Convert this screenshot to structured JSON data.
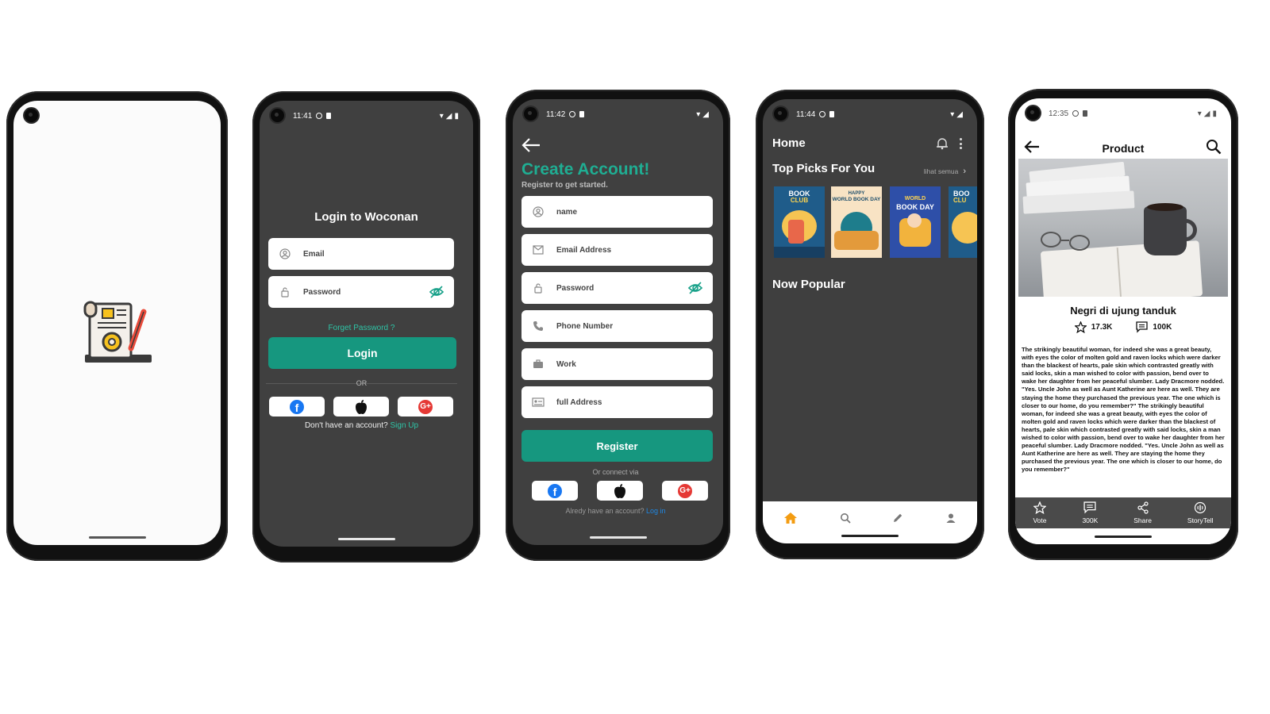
{
  "login": {
    "time": "11:41",
    "title": "Login to Woconan",
    "email_placeholder": "Email",
    "password_placeholder": "Password",
    "forgot": "Forget Password ?",
    "login_button": "Login",
    "or": "OR",
    "no_account": "Don't have an account?",
    "signup": "Sign Up"
  },
  "register": {
    "time": "11:42",
    "title": "Create Account!",
    "subtitle": "Register to get started.",
    "fields": [
      "name",
      "Email Address",
      "Password",
      "Phone Number",
      "Work",
      "full Address"
    ],
    "register_button": "Register",
    "connect_via": "Or connect via",
    "have_account": "Alredy have an account?",
    "login_link": "Log in"
  },
  "home": {
    "time": "11:44",
    "title": "Home",
    "top_picks": "Top Picks For You",
    "see_all": "lihat semua",
    "now_popular": "Now Popular",
    "covers": [
      {
        "line1": "BOOK",
        "line2": "CLUB"
      },
      {
        "line1": "HAPPY",
        "line2": "WORLD BOOK DAY"
      },
      {
        "line1": "WORLD",
        "line2": "BOOK DAY"
      },
      {
        "line1": "BOO",
        "line2": "CLU"
      }
    ]
  },
  "product": {
    "time": "12:35",
    "title": "Product",
    "book_title": "Negri di ujung tanduk",
    "votes": "17.3K",
    "comments": "100K",
    "description": "The strikingly beautiful woman, for indeed she was a great beauty, with eyes the color of molten gold and raven locks which were darker than the blackest of hearts, pale skin which contrasted greatly with said locks, skin a man wished to color with passion, bend over to wake her daughter from her peaceful slumber. Lady Dracmore nodded. \"Yes. Uncle John as well as Aunt Katherine are here as well. They are staying the home they purchased the previous year. The one which is closer to our home, do you remember?\" The strikingly beautiful woman, for indeed she was a great beauty, with eyes the color of molten gold and raven locks which were darker than the blackest of hearts, pale skin which contrasted greatly with said locks, skin a man wished to color with passion, bend over to wake her daughter from her peaceful slumber. Lady Dracmore nodded. \"Yes. Uncle John as well as Aunt Katherine are here as well. They are staying the home they purchased the previous year. The one which is closer to our home, do you remember?\"",
    "bottom_nav": [
      "Vote",
      "300K",
      "Share",
      "StoryTell"
    ]
  },
  "colors": {
    "accent": "#16977f",
    "dark_bg": "#404040",
    "link_blue": "#1e88e5",
    "orange_nav": "#f39c12"
  }
}
